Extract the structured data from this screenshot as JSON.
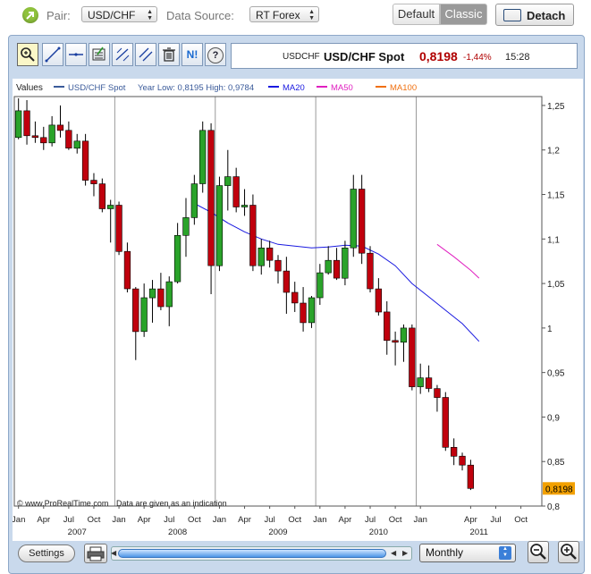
{
  "header": {
    "pair_label": "Pair:",
    "pair_value": "USD/CHF",
    "source_label": "Data Source:",
    "source_value": "RT Forex",
    "view_default": "Default",
    "view_classic": "Classic",
    "detach_label": "Detach"
  },
  "toolbar": {
    "icons": [
      "zoom-box-icon",
      "draw-line-icon",
      "horizontal-line-icon",
      "indicators-icon",
      "fibonacci-icon",
      "channel-icon",
      "trash-icon",
      "news-icon",
      "help-icon"
    ],
    "news_label": "N!",
    "help_label": "?"
  },
  "quote": {
    "symbol": "USDCHF",
    "name": "USD/CHF Spot",
    "price": "0,8198",
    "change": "-1,44%",
    "time": "15:28"
  },
  "legend": {
    "values_label": "Values",
    "series_label": "USD/CHF Spot",
    "year_range": "Year Low: 0,8195 High: 0,9784",
    "ma20": "MA20",
    "ma50": "MA50",
    "ma100": "MA100"
  },
  "footer": {
    "copyright": "© www.ProRealTime.com",
    "disclaimer": "Data are given as an indication",
    "settings_label": "Settings",
    "period_value": "Monthly"
  },
  "colors": {
    "up": "#2aa32a",
    "down": "#c0000d",
    "ma20": "#1a1ae0",
    "ma50": "#e020c0",
    "ma100": "#f07010",
    "price_tag": "#f2a000"
  },
  "chart_data": {
    "type": "candlestick",
    "ylim": [
      0.8,
      1.26
    ],
    "yticks": [
      "1,25",
      "1,2",
      "1,15",
      "1,1",
      "1,05",
      "1",
      "0,95",
      "0,9",
      "0,85",
      "0,8"
    ],
    "ytick_values": [
      1.25,
      1.2,
      1.15,
      1.1,
      1.05,
      1.0,
      0.95,
      0.9,
      0.85,
      0.8
    ],
    "last_price_label": "0,8198",
    "last_price": 0.8198,
    "x_month_labels": [
      "Jan",
      "Apr",
      "Jul",
      "Oct",
      "Jan",
      "Apr",
      "Jul",
      "Oct",
      "Jan",
      "Apr",
      "Jul",
      "Oct",
      "Jan",
      "Apr",
      "Jul",
      "Oct",
      "Jan",
      "Apr",
      "Jul",
      "Oct"
    ],
    "x_month_index": [
      0,
      3,
      6,
      9,
      12,
      15,
      18,
      21,
      24,
      27,
      30,
      33,
      36,
      39,
      42,
      45,
      48,
      54,
      57,
      60
    ],
    "x_year_labels": [
      "2007",
      "2008",
      "2009",
      "2010",
      "2011"
    ],
    "x_year_index": [
      7,
      19,
      31,
      43,
      55
    ],
    "x_months": 63,
    "candles": [
      {
        "o": 1.214,
        "h": 1.258,
        "l": 1.212,
        "c": 1.244
      },
      {
        "o": 1.244,
        "h": 1.256,
        "l": 1.206,
        "c": 1.216
      },
      {
        "o": 1.216,
        "h": 1.232,
        "l": 1.208,
        "c": 1.214
      },
      {
        "o": 1.214,
        "h": 1.226,
        "l": 1.2,
        "c": 1.208
      },
      {
        "o": 1.208,
        "h": 1.238,
        "l": 1.204,
        "c": 1.228
      },
      {
        "o": 1.228,
        "h": 1.25,
        "l": 1.214,
        "c": 1.222
      },
      {
        "o": 1.222,
        "h": 1.232,
        "l": 1.2,
        "c": 1.202
      },
      {
        "o": 1.202,
        "h": 1.218,
        "l": 1.196,
        "c": 1.21
      },
      {
        "o": 1.21,
        "h": 1.218,
        "l": 1.16,
        "c": 1.166
      },
      {
        "o": 1.166,
        "h": 1.174,
        "l": 1.148,
        "c": 1.162
      },
      {
        "o": 1.162,
        "h": 1.168,
        "l": 1.13,
        "c": 1.134
      },
      {
        "o": 1.134,
        "h": 1.144,
        "l": 1.096,
        "c": 1.138
      },
      {
        "o": 1.138,
        "h": 1.142,
        "l": 1.082,
        "c": 1.086
      },
      {
        "o": 1.086,
        "h": 1.096,
        "l": 1.04,
        "c": 1.044
      },
      {
        "o": 1.044,
        "h": 1.046,
        "l": 0.964,
        "c": 0.996
      },
      {
        "o": 0.996,
        "h": 1.05,
        "l": 0.99,
        "c": 1.034
      },
      {
        "o": 1.034,
        "h": 1.054,
        "l": 1.006,
        "c": 1.044
      },
      {
        "o": 1.044,
        "h": 1.062,
        "l": 1.02,
        "c": 1.024
      },
      {
        "o": 1.024,
        "h": 1.058,
        "l": 1.002,
        "c": 1.052
      },
      {
        "o": 1.052,
        "h": 1.118,
        "l": 1.05,
        "c": 1.104
      },
      {
        "o": 1.104,
        "h": 1.146,
        "l": 1.08,
        "c": 1.124
      },
      {
        "o": 1.124,
        "h": 1.172,
        "l": 1.116,
        "c": 1.162
      },
      {
        "o": 1.162,
        "h": 1.232,
        "l": 1.152,
        "c": 1.222
      },
      {
        "o": 1.222,
        "h": 1.23,
        "l": 1.038,
        "c": 1.07
      },
      {
        "o": 1.07,
        "h": 1.17,
        "l": 1.064,
        "c": 1.16
      },
      {
        "o": 1.16,
        "h": 1.2,
        "l": 1.132,
        "c": 1.17
      },
      {
        "o": 1.17,
        "h": 1.18,
        "l": 1.13,
        "c": 1.136
      },
      {
        "o": 1.136,
        "h": 1.156,
        "l": 1.126,
        "c": 1.138
      },
      {
        "o": 1.138,
        "h": 1.15,
        "l": 1.064,
        "c": 1.07
      },
      {
        "o": 1.07,
        "h": 1.1,
        "l": 1.06,
        "c": 1.09
      },
      {
        "o": 1.09,
        "h": 1.098,
        "l": 1.068,
        "c": 1.076
      },
      {
        "o": 1.076,
        "h": 1.082,
        "l": 1.05,
        "c": 1.064
      },
      {
        "o": 1.064,
        "h": 1.08,
        "l": 1.016,
        "c": 1.04
      },
      {
        "o": 1.04,
        "h": 1.052,
        "l": 1.018,
        "c": 1.028
      },
      {
        "o": 1.028,
        "h": 1.046,
        "l": 0.996,
        "c": 1.006
      },
      {
        "o": 1.006,
        "h": 1.036,
        "l": 1.0,
        "c": 1.034
      },
      {
        "o": 1.034,
        "h": 1.072,
        "l": 1.026,
        "c": 1.062
      },
      {
        "o": 1.062,
        "h": 1.092,
        "l": 1.06,
        "c": 1.076
      },
      {
        "o": 1.076,
        "h": 1.09,
        "l": 1.054,
        "c": 1.056
      },
      {
        "o": 1.056,
        "h": 1.098,
        "l": 1.048,
        "c": 1.09
      },
      {
        "o": 1.09,
        "h": 1.172,
        "l": 1.08,
        "c": 1.156
      },
      {
        "o": 1.156,
        "h": 1.172,
        "l": 1.072,
        "c": 1.084
      },
      {
        "o": 1.084,
        "h": 1.092,
        "l": 1.04,
        "c": 1.044
      },
      {
        "o": 1.044,
        "h": 1.056,
        "l": 1.014,
        "c": 1.018
      },
      {
        "o": 1.018,
        "h": 1.03,
        "l": 0.97,
        "c": 0.986
      },
      {
        "o": 0.986,
        "h": 0.996,
        "l": 0.958,
        "c": 0.984
      },
      {
        "o": 0.984,
        "h": 1.004,
        "l": 0.962,
        "c": 1.0
      },
      {
        "o": 1.0,
        "h": 1.004,
        "l": 0.93,
        "c": 0.934
      },
      {
        "o": 0.934,
        "h": 0.96,
        "l": 0.926,
        "c": 0.944
      },
      {
        "o": 0.944,
        "h": 0.958,
        "l": 0.928,
        "c": 0.932
      },
      {
        "o": 0.932,
        "h": 0.936,
        "l": 0.906,
        "c": 0.922
      },
      {
        "o": 0.922,
        "h": 0.928,
        "l": 0.862,
        "c": 0.866
      },
      {
        "o": 0.866,
        "h": 0.876,
        "l": 0.846,
        "c": 0.856
      },
      {
        "o": 0.856,
        "h": 0.86,
        "l": 0.84,
        "c": 0.846
      },
      {
        "o": 0.846,
        "h": 0.852,
        "l": 0.818,
        "c": 0.8198
      }
    ],
    "ma20_points": [
      [
        21,
        1.14
      ],
      [
        23,
        1.13
      ],
      [
        25,
        1.118
      ],
      [
        27,
        1.108
      ],
      [
        29,
        1.1
      ],
      [
        31,
        1.094
      ],
      [
        33,
        1.092
      ],
      [
        35,
        1.09
      ],
      [
        37,
        1.091
      ],
      [
        39,
        1.093
      ],
      [
        41,
        1.092
      ],
      [
        43,
        1.083
      ],
      [
        45,
        1.07
      ],
      [
        47,
        1.05
      ],
      [
        49,
        1.035
      ],
      [
        51,
        1.02
      ],
      [
        53,
        1.005
      ],
      [
        55,
        0.985
      ]
    ],
    "ma50_points": [
      [
        50,
        1.094
      ],
      [
        52,
        1.08
      ],
      [
        54,
        1.065
      ],
      [
        55,
        1.056
      ]
    ]
  }
}
